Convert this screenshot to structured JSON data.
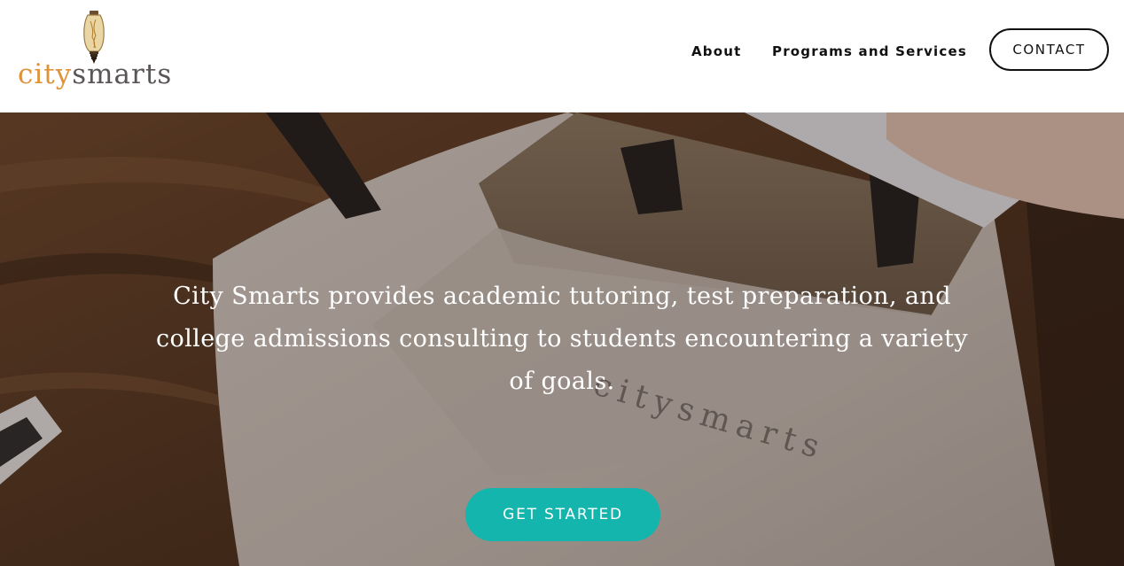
{
  "colors": {
    "accent": "#14b5ac",
    "brand_orange": "#e0923a",
    "brand_gray": "#5b5656",
    "nav_text": "#111111"
  },
  "header": {
    "logo": {
      "city": "city",
      "smarts": "smarts",
      "icon": "lightbulb-icon"
    },
    "nav": {
      "about": "About",
      "programs": "Programs and Services",
      "contact": "CONTACT"
    }
  },
  "hero": {
    "tagline": "City Smarts provides academic tutoring, test preparation, and college admissions consulting to students encountering a variety of goals.",
    "cta_label": "GET STARTED",
    "bag_print": {
      "city": "city",
      "smarts": "smarts"
    }
  }
}
